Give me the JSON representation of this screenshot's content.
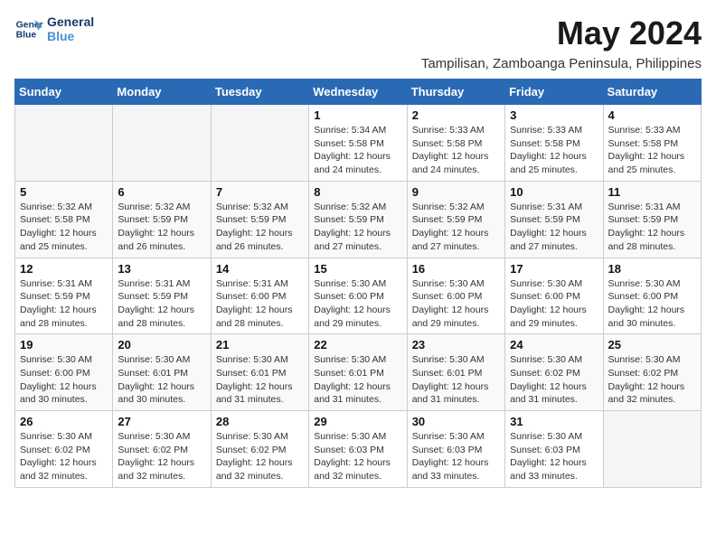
{
  "logo": {
    "line1": "General",
    "line2": "Blue"
  },
  "title": "May 2024",
  "subtitle": "Tampilisan, Zamboanga Peninsula, Philippines",
  "weekdays": [
    "Sunday",
    "Monday",
    "Tuesday",
    "Wednesday",
    "Thursday",
    "Friday",
    "Saturday"
  ],
  "weeks": [
    [
      {
        "day": "",
        "info": ""
      },
      {
        "day": "",
        "info": ""
      },
      {
        "day": "",
        "info": ""
      },
      {
        "day": "1",
        "info": "Sunrise: 5:34 AM\nSunset: 5:58 PM\nDaylight: 12 hours\nand 24 minutes."
      },
      {
        "day": "2",
        "info": "Sunrise: 5:33 AM\nSunset: 5:58 PM\nDaylight: 12 hours\nand 24 minutes."
      },
      {
        "day": "3",
        "info": "Sunrise: 5:33 AM\nSunset: 5:58 PM\nDaylight: 12 hours\nand 25 minutes."
      },
      {
        "day": "4",
        "info": "Sunrise: 5:33 AM\nSunset: 5:58 PM\nDaylight: 12 hours\nand 25 minutes."
      }
    ],
    [
      {
        "day": "5",
        "info": "Sunrise: 5:32 AM\nSunset: 5:58 PM\nDaylight: 12 hours\nand 25 minutes."
      },
      {
        "day": "6",
        "info": "Sunrise: 5:32 AM\nSunset: 5:59 PM\nDaylight: 12 hours\nand 26 minutes."
      },
      {
        "day": "7",
        "info": "Sunrise: 5:32 AM\nSunset: 5:59 PM\nDaylight: 12 hours\nand 26 minutes."
      },
      {
        "day": "8",
        "info": "Sunrise: 5:32 AM\nSunset: 5:59 PM\nDaylight: 12 hours\nand 27 minutes."
      },
      {
        "day": "9",
        "info": "Sunrise: 5:32 AM\nSunset: 5:59 PM\nDaylight: 12 hours\nand 27 minutes."
      },
      {
        "day": "10",
        "info": "Sunrise: 5:31 AM\nSunset: 5:59 PM\nDaylight: 12 hours\nand 27 minutes."
      },
      {
        "day": "11",
        "info": "Sunrise: 5:31 AM\nSunset: 5:59 PM\nDaylight: 12 hours\nand 28 minutes."
      }
    ],
    [
      {
        "day": "12",
        "info": "Sunrise: 5:31 AM\nSunset: 5:59 PM\nDaylight: 12 hours\nand 28 minutes."
      },
      {
        "day": "13",
        "info": "Sunrise: 5:31 AM\nSunset: 5:59 PM\nDaylight: 12 hours\nand 28 minutes."
      },
      {
        "day": "14",
        "info": "Sunrise: 5:31 AM\nSunset: 6:00 PM\nDaylight: 12 hours\nand 28 minutes."
      },
      {
        "day": "15",
        "info": "Sunrise: 5:30 AM\nSunset: 6:00 PM\nDaylight: 12 hours\nand 29 minutes."
      },
      {
        "day": "16",
        "info": "Sunrise: 5:30 AM\nSunset: 6:00 PM\nDaylight: 12 hours\nand 29 minutes."
      },
      {
        "day": "17",
        "info": "Sunrise: 5:30 AM\nSunset: 6:00 PM\nDaylight: 12 hours\nand 29 minutes."
      },
      {
        "day": "18",
        "info": "Sunrise: 5:30 AM\nSunset: 6:00 PM\nDaylight: 12 hours\nand 30 minutes."
      }
    ],
    [
      {
        "day": "19",
        "info": "Sunrise: 5:30 AM\nSunset: 6:00 PM\nDaylight: 12 hours\nand 30 minutes."
      },
      {
        "day": "20",
        "info": "Sunrise: 5:30 AM\nSunset: 6:01 PM\nDaylight: 12 hours\nand 30 minutes."
      },
      {
        "day": "21",
        "info": "Sunrise: 5:30 AM\nSunset: 6:01 PM\nDaylight: 12 hours\nand 31 minutes."
      },
      {
        "day": "22",
        "info": "Sunrise: 5:30 AM\nSunset: 6:01 PM\nDaylight: 12 hours\nand 31 minutes."
      },
      {
        "day": "23",
        "info": "Sunrise: 5:30 AM\nSunset: 6:01 PM\nDaylight: 12 hours\nand 31 minutes."
      },
      {
        "day": "24",
        "info": "Sunrise: 5:30 AM\nSunset: 6:02 PM\nDaylight: 12 hours\nand 31 minutes."
      },
      {
        "day": "25",
        "info": "Sunrise: 5:30 AM\nSunset: 6:02 PM\nDaylight: 12 hours\nand 32 minutes."
      }
    ],
    [
      {
        "day": "26",
        "info": "Sunrise: 5:30 AM\nSunset: 6:02 PM\nDaylight: 12 hours\nand 32 minutes."
      },
      {
        "day": "27",
        "info": "Sunrise: 5:30 AM\nSunset: 6:02 PM\nDaylight: 12 hours\nand 32 minutes."
      },
      {
        "day": "28",
        "info": "Sunrise: 5:30 AM\nSunset: 6:02 PM\nDaylight: 12 hours\nand 32 minutes."
      },
      {
        "day": "29",
        "info": "Sunrise: 5:30 AM\nSunset: 6:03 PM\nDaylight: 12 hours\nand 32 minutes."
      },
      {
        "day": "30",
        "info": "Sunrise: 5:30 AM\nSunset: 6:03 PM\nDaylight: 12 hours\nand 33 minutes."
      },
      {
        "day": "31",
        "info": "Sunrise: 5:30 AM\nSunset: 6:03 PM\nDaylight: 12 hours\nand 33 minutes."
      },
      {
        "day": "",
        "info": ""
      }
    ]
  ]
}
